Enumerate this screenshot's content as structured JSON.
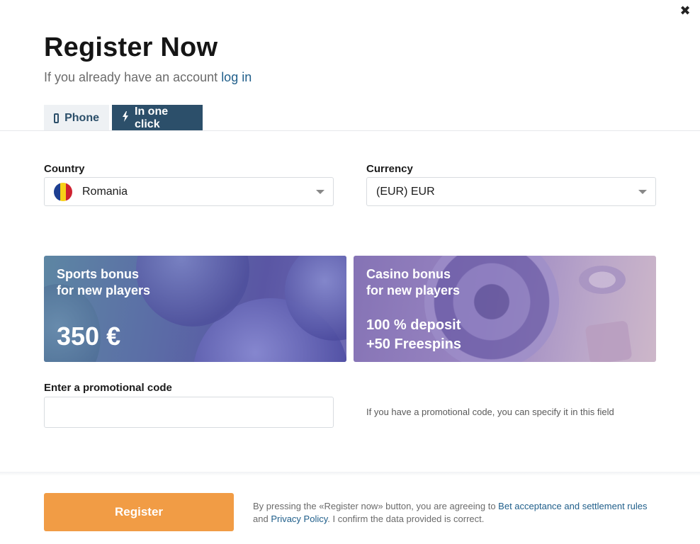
{
  "close_label": "✖",
  "title": "Register Now",
  "subtitle": {
    "text": "If you already have an account",
    "link": "log in"
  },
  "tabs": [
    {
      "label": "Phone",
      "icon": "phone-icon",
      "active": false
    },
    {
      "label": "In one click",
      "icon": "lightning-icon",
      "active": true
    }
  ],
  "country": {
    "label": "Country",
    "value": "Romania",
    "flag_colors": [
      "#1d3f91",
      "#f7d117",
      "#cf2230"
    ]
  },
  "currency": {
    "label": "Currency",
    "value": "(EUR) EUR"
  },
  "bonuses": {
    "sports": {
      "line1": "Sports bonus",
      "line2": "for new players",
      "amount": "350 €"
    },
    "casino": {
      "line1": "Casino bonus",
      "line2": "for new players",
      "offer1": "100 % deposit",
      "offer2": "+50 Freespins"
    }
  },
  "promo": {
    "label": "Enter a promotional code",
    "value": "",
    "hint": "If you have a promotional code, you can specify it in this field"
  },
  "register": {
    "button_label": "Register",
    "terms_prefix": "By pressing the «Register now» button, you are agreeing to ",
    "terms_link1": "Bet acceptance and settlement rules",
    "terms_and": " and ",
    "terms_link2": "Privacy Policy",
    "terms_suffix": ". I confirm the data provided is correct."
  },
  "colors": {
    "accent": "#2c4f6a",
    "link": "#1f5e8a",
    "register": "#f19c45"
  }
}
